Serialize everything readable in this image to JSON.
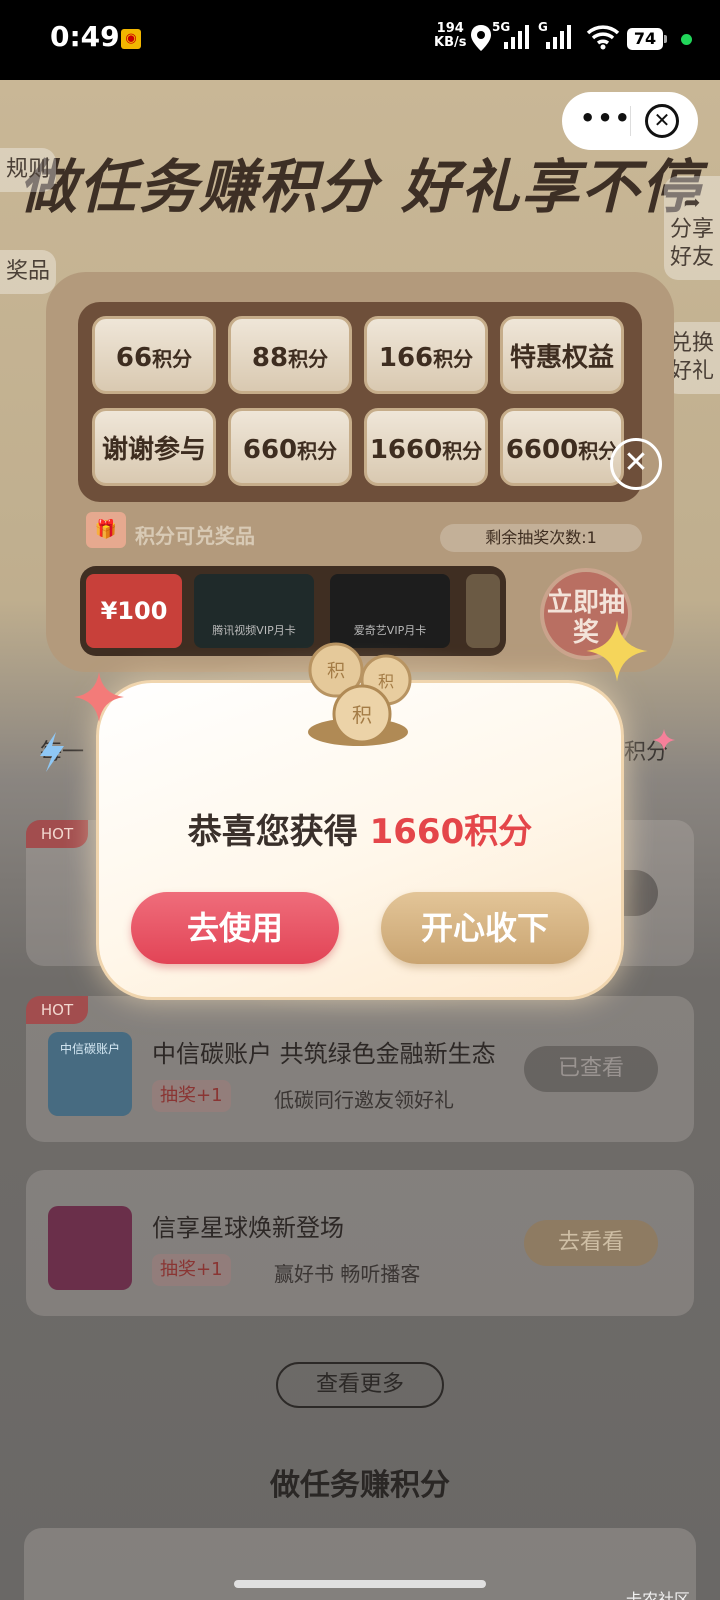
{
  "status_bar": {
    "time": "0:49",
    "net_speed_value": "194",
    "net_speed_unit": "KB/s",
    "signal_1": "5G",
    "signal_2": "G",
    "battery": "74"
  },
  "colors": {
    "accent_red": "#e4464a",
    "gold": "#c9a471",
    "use_button": "#e24456"
  },
  "page": {
    "hero_title": "做任务赚积分 好礼享不停",
    "left_tabs": [
      "规则",
      "奖品"
    ],
    "right_tabs": [
      "分享好友",
      "兑换好礼"
    ],
    "prizes": [
      {
        "num": "66",
        "unit": "积分"
      },
      {
        "num": "88",
        "unit": "积分"
      },
      {
        "num": "166",
        "unit": "积分"
      },
      {
        "num": "特惠权益",
        "unit": ""
      },
      {
        "num": "谢谢参与",
        "unit": ""
      },
      {
        "num": "660",
        "unit": "积分"
      },
      {
        "num": "1660",
        "unit": "积分"
      },
      {
        "num": "6600",
        "unit": "积分"
      }
    ],
    "redeem_label": "积分可兑奖品",
    "remaining": "剩余抽奖次数:1",
    "draw_button": "立即抽奖",
    "strip_cards": [
      "¥100",
      "腾讯视频VIP月卡",
      "爱奇艺VIP月卡"
    ],
    "subtitle_left": "每一",
    "subtitle_right": "积分",
    "more_button": "查看更多",
    "section_title": "做任务赚积分"
  },
  "tasks": [
    {
      "hot": "HOT",
      "title": "",
      "badge": "",
      "subtitle": "",
      "button": ""
    },
    {
      "hot": "HOT",
      "thumb": "中信碳账户",
      "title": "中信碳账户 共筑绿色金融新生态",
      "badge": "抽奖+1",
      "subtitle": "低碳同行邀友领好礼",
      "button": "已查看"
    },
    {
      "hot": "",
      "thumb": "",
      "title": "信享星球焕新登场",
      "badge": "抽奖+1",
      "subtitle": "赢好书 畅听播客",
      "button": "去看看"
    }
  ],
  "popup": {
    "congrats_prefix": "恭喜您获得",
    "congrats_amount": "1660积分",
    "use_button": "去使用",
    "accept_button": "开心收下"
  },
  "watermark": "卡农社区"
}
